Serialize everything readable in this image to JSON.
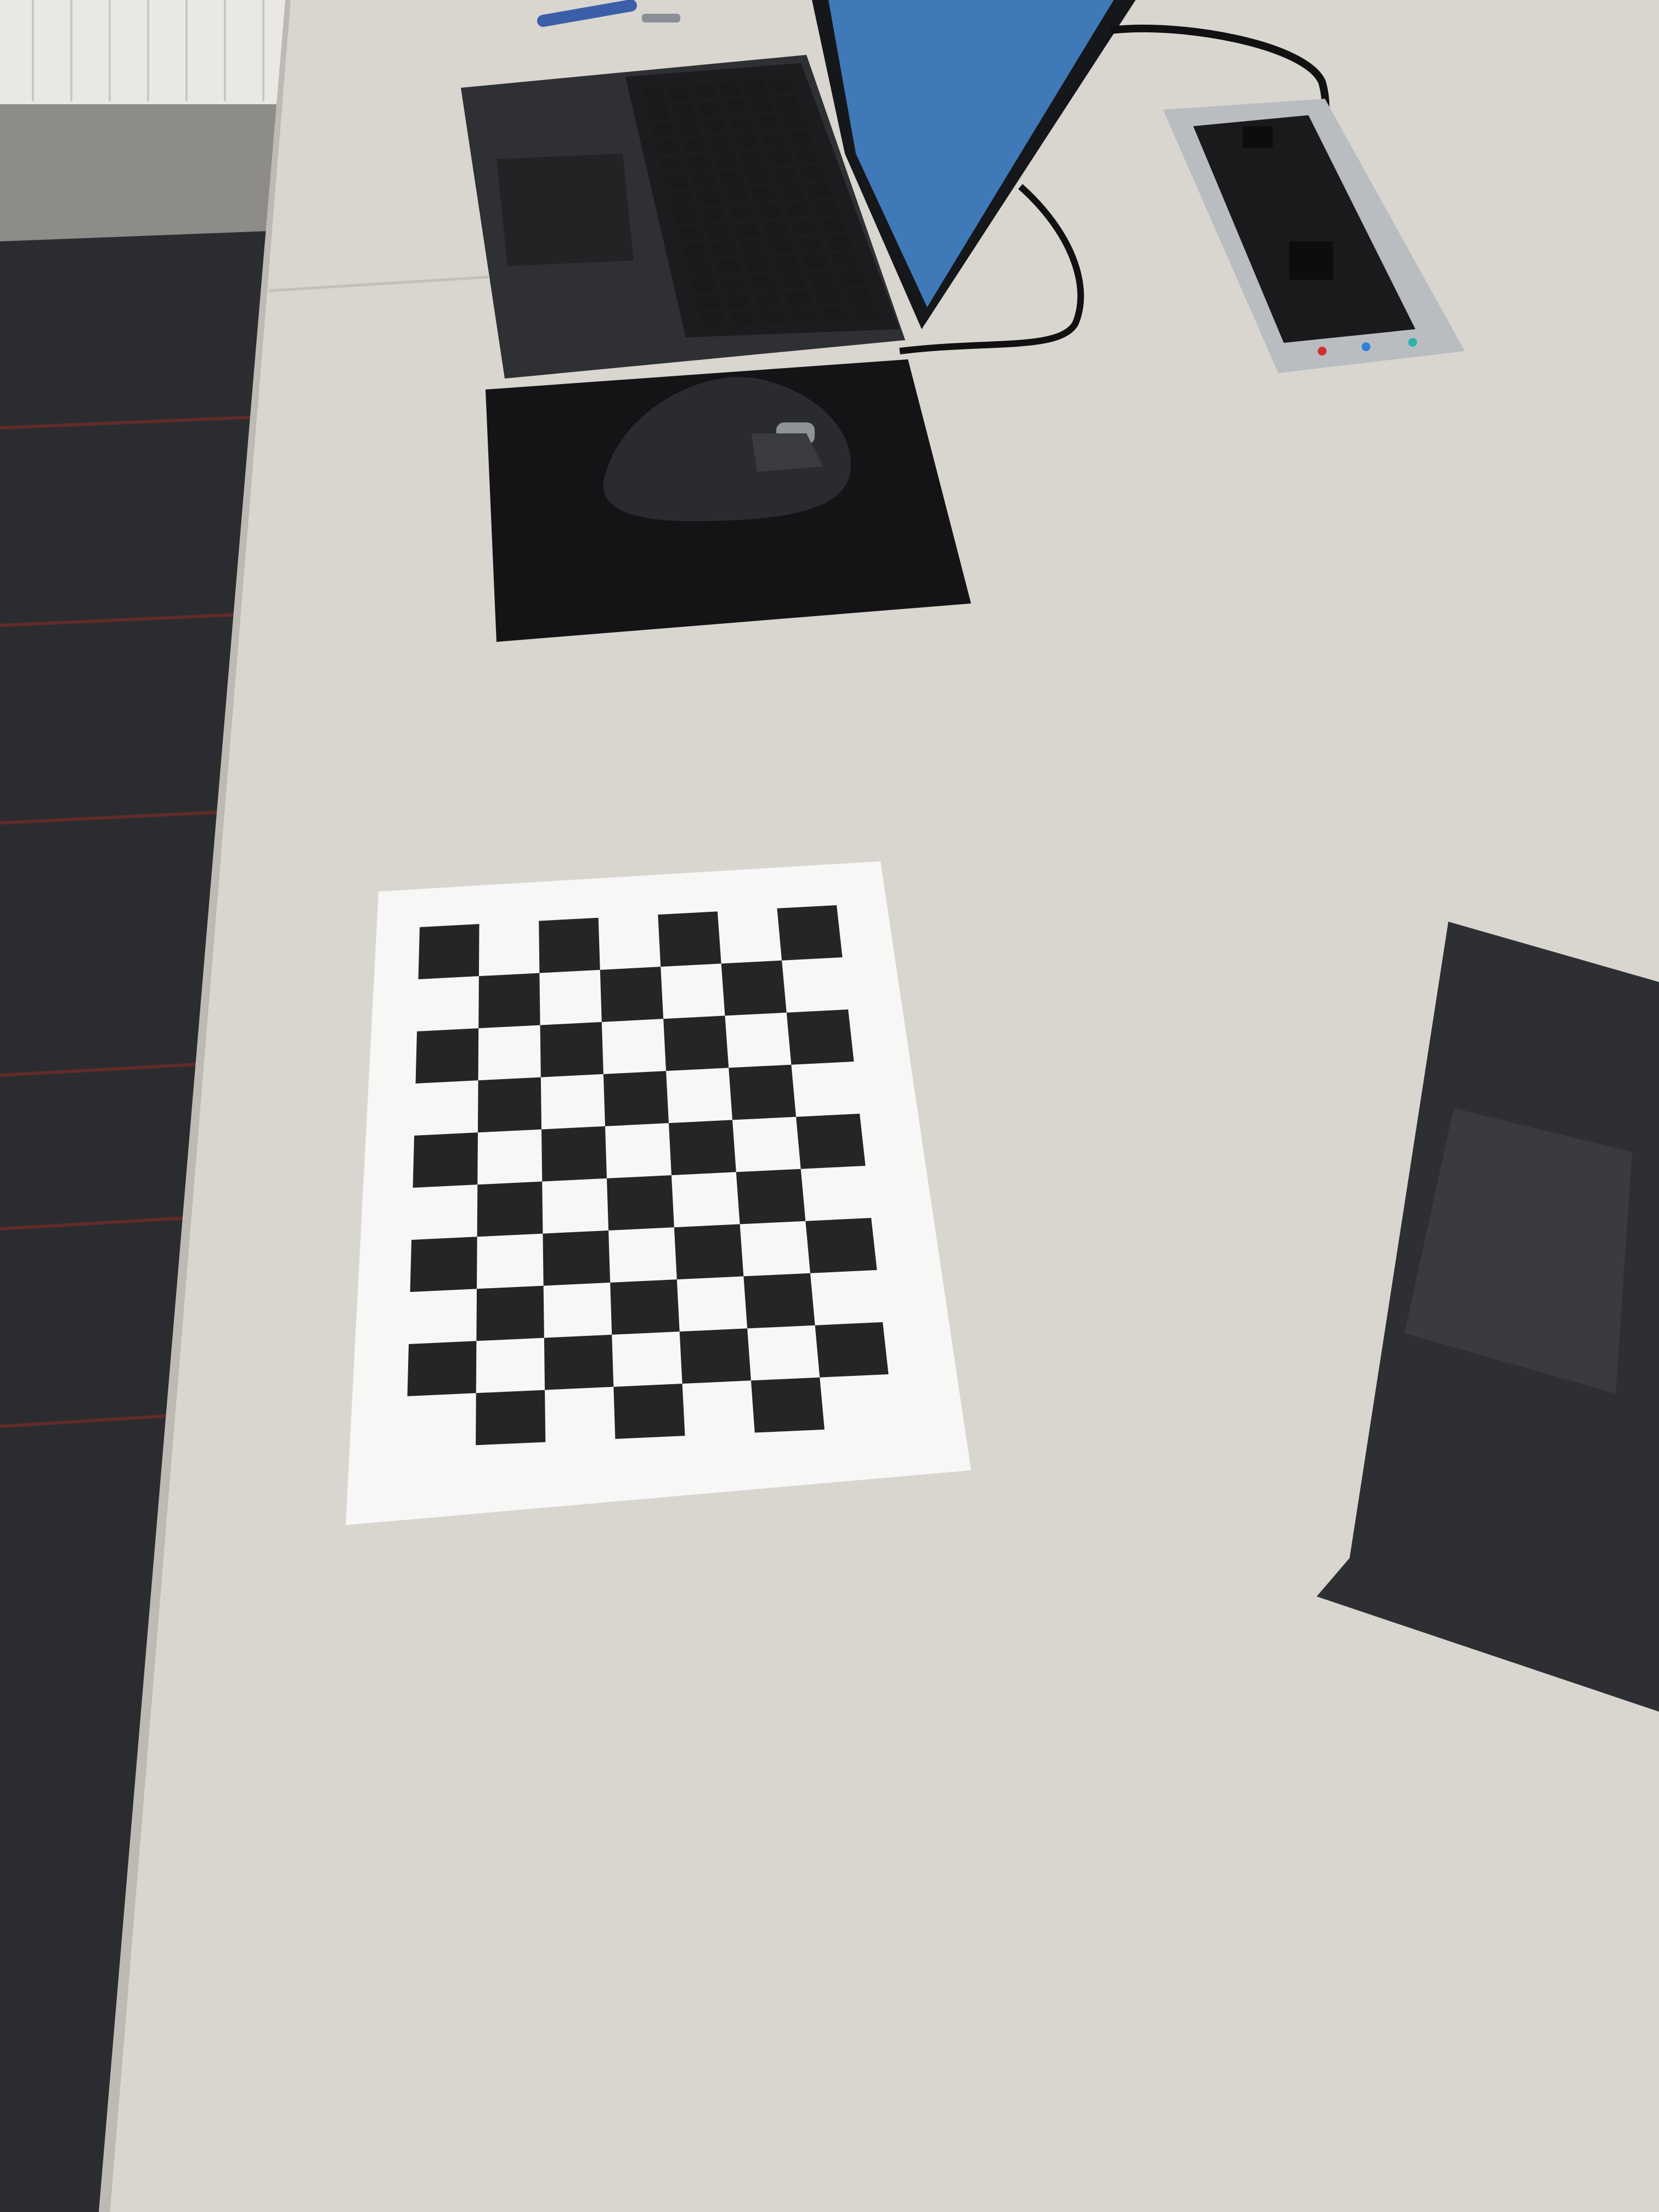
{
  "scene": {
    "description_free": true,
    "colors": {
      "carpet": "#2b2c30",
      "carpet_stripe": "#7a2b26",
      "desk": "#d9d6d0",
      "desk_shadow": "#c8c5be",
      "laptop_body": "#2f3033",
      "laptop_keys": "#141416",
      "screen": "#3f79b8",
      "mousepad": "#141416",
      "mouse": "#2a2b2e",
      "paper": "#f7f7f6",
      "checker_dark": "#262424",
      "power_outlet_frame": "#b9bcc0"
    },
    "objects": [
      {
        "name": "open-laptop",
        "interactable": true
      },
      {
        "name": "mouse-pad",
        "interactable": false
      },
      {
        "name": "computer-mouse",
        "interactable": true
      },
      {
        "name": "desk-power-outlet",
        "interactable": false
      },
      {
        "name": "checkerboard-paper",
        "interactable": false
      },
      {
        "name": "second-laptop-palmrest",
        "interactable": false
      },
      {
        "name": "pen",
        "interactable": false
      }
    ],
    "checkerboard": {
      "rows": 10,
      "cols": 7,
      "first_dark_on_even_row": true
    }
  }
}
